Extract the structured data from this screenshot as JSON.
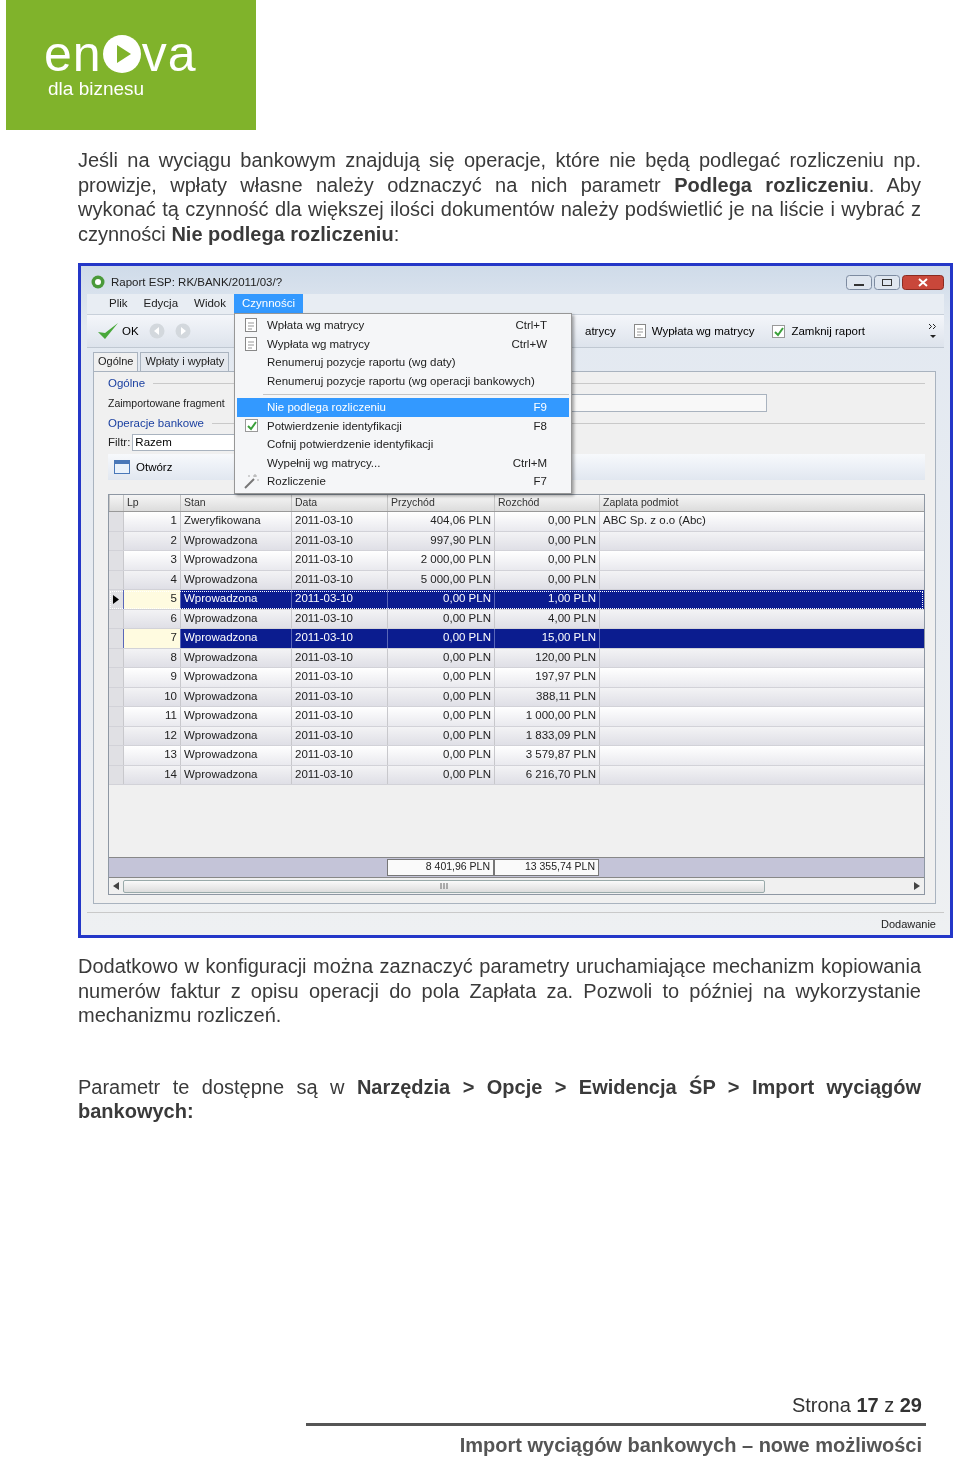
{
  "logo": {
    "left": "en",
    "right": "va",
    "tagline": "dla biznesu"
  },
  "intro": "Jeśli na wyciągu bankowym znajdują się operacje, które nie będą podlegać rozliczeniu np. prowizje, wpłaty własne należy odznaczyć na nich parametr **Podlega rozliczeniu**. Aby wykonać tą czynność dla większej ilości dokumentów należy podświetlić je na liście i wybrać z czynności **Nie podlega rozliczeniu**:",
  "window": {
    "title": "Raport ESP: RK/BANK/2011/03/?",
    "menubar": [
      {
        "label": "Plik",
        "selected": false
      },
      {
        "label": "Edycja",
        "selected": false
      },
      {
        "label": "Widok",
        "selected": false
      },
      {
        "label": "Czynności",
        "selected": true
      }
    ],
    "toolbar": [
      {
        "kind": "text",
        "label": "atrycy"
      },
      {
        "kind": "doc",
        "label": "Wypłata wg matrycy"
      },
      {
        "kind": "check",
        "label": "Zamknij raport"
      }
    ],
    "ok_button": "OK",
    "tabs": [
      {
        "label": "Ogólne",
        "selected": true
      },
      {
        "label": "Wpłaty i wypłaty",
        "selected": false
      }
    ],
    "general_heading": "Ogólne",
    "imported_label": "Zaimportowane fragment",
    "bank_heading": "Operacje bankowe",
    "filter_label": "Filtr:",
    "filter_value": "Razem",
    "open_button": "Otwórz",
    "menu": [
      {
        "kind": "doc",
        "label": "Wpłata wg matrycy",
        "shortcut": "Ctrl+T",
        "selected": false
      },
      {
        "kind": "doc",
        "label": "Wypłata wg matrycy",
        "shortcut": "Ctrl+W",
        "selected": false
      },
      {
        "kind": "plain",
        "label": "Renumeruj pozycje raportu (wg daty)",
        "selected": false
      },
      {
        "kind": "plain",
        "label": "Renumeruj pozycje raportu (wg operacji bankowych)",
        "selected": false
      },
      {
        "kind": "separator"
      },
      {
        "kind": "plain",
        "label": "Nie podlega rozliczeniu",
        "shortcut": "F9",
        "selected": true
      },
      {
        "kind": "check",
        "label": "Potwierdzenie identyfikacji",
        "shortcut": "F8",
        "selected": false
      },
      {
        "kind": "plain",
        "label": "Cofnij potwierdzenie identyfikacji",
        "selected": false
      },
      {
        "kind": "plain",
        "label": "Wypełnij wg matrycy...",
        "shortcut": "Ctrl+M",
        "selected": false
      },
      {
        "kind": "wand",
        "label": "Rozliczenie",
        "shortcut": "F7",
        "selected": false
      }
    ],
    "table": {
      "columns": [
        "Lp",
        "Stan",
        "Data",
        "Przychód",
        "Rozchód",
        "Zaplata podmiot"
      ],
      "rows": [
        {
          "cells": [
            "1",
            "Zweryfikowana",
            "2011-03-10",
            "404,06 PLN",
            "0,00 PLN",
            "ABC Sp. z o.o (Abc)"
          ],
          "selected": false,
          "current": false
        },
        {
          "cells": [
            "2",
            "Wprowadzona",
            "2011-03-10",
            "997,90 PLN",
            "0,00 PLN"
          ],
          "selected": false,
          "current": false
        },
        {
          "cells": [
            "3",
            "Wprowadzona",
            "2011-03-10",
            "2 000,00 PLN",
            "0,00 PLN"
          ],
          "selected": false,
          "current": false
        },
        {
          "cells": [
            "4",
            "Wprowadzona",
            "2011-03-10",
            "5 000,00 PLN",
            "0,00 PLN"
          ],
          "selected": false,
          "current": false
        },
        {
          "cells": [
            "5",
            "Wprowadzona",
            "2011-03-10",
            "0,00 PLN",
            "1,00 PLN"
          ],
          "selected": true,
          "current": true
        },
        {
          "cells": [
            "6",
            "Wprowadzona",
            "2011-03-10",
            "0,00 PLN",
            "4,00 PLN"
          ],
          "selected": false,
          "current": false
        },
        {
          "cells": [
            "7",
            "Wprowadzona",
            "2011-03-10",
            "0,00 PLN",
            "15,00 PLN"
          ],
          "selected": true,
          "current": false
        },
        {
          "cells": [
            "8",
            "Wprowadzona",
            "2011-03-10",
            "0,00 PLN",
            "120,00 PLN"
          ],
          "selected": false,
          "current": false
        },
        {
          "cells": [
            "9",
            "Wprowadzona",
            "2011-03-10",
            "0,00 PLN",
            "197,97 PLN"
          ],
          "selected": false,
          "current": false
        },
        {
          "cells": [
            "10",
            "Wprowadzona",
            "2011-03-10",
            "0,00 PLN",
            "388,11 PLN"
          ],
          "selected": false,
          "current": false
        },
        {
          "cells": [
            "11",
            "Wprowadzona",
            "2011-03-10",
            "0,00 PLN",
            "1 000,00 PLN"
          ],
          "selected": false,
          "current": false
        },
        {
          "cells": [
            "12",
            "Wprowadzona",
            "2011-03-10",
            "0,00 PLN",
            "1 833,09 PLN"
          ],
          "selected": false,
          "current": false
        },
        {
          "cells": [
            "13",
            "Wprowadzona",
            "2011-03-10",
            "0,00 PLN",
            "3 579,87 PLN"
          ],
          "selected": false,
          "current": false
        },
        {
          "cells": [
            "14",
            "Wprowadzona",
            "2011-03-10",
            "0,00 PLN",
            "6 216,70 PLN"
          ],
          "selected": false,
          "current": false
        }
      ],
      "totals": [
        "8 401,96 PLN",
        "13 355,74 PLN"
      ]
    },
    "status": "Dodawanie"
  },
  "paragraphs": [
    "Dodatkowo w konfiguracji można zaznaczyć parametry uruchamiające mechanizm kopiowania numerów faktur z opisu operacji do pola Zapłata za. Pozwoli to później na wykorzystanie mechanizmu rozliczeń.",
    "Parametr te dostępne są w **Narzędzia > Opcje > Ewidencja ŚP > Import wyciągów bankowych:**"
  ],
  "footer": {
    "page": "Strona **17** z **29**",
    "title": "Import wyciągów bankowych – nowe możliwości"
  }
}
